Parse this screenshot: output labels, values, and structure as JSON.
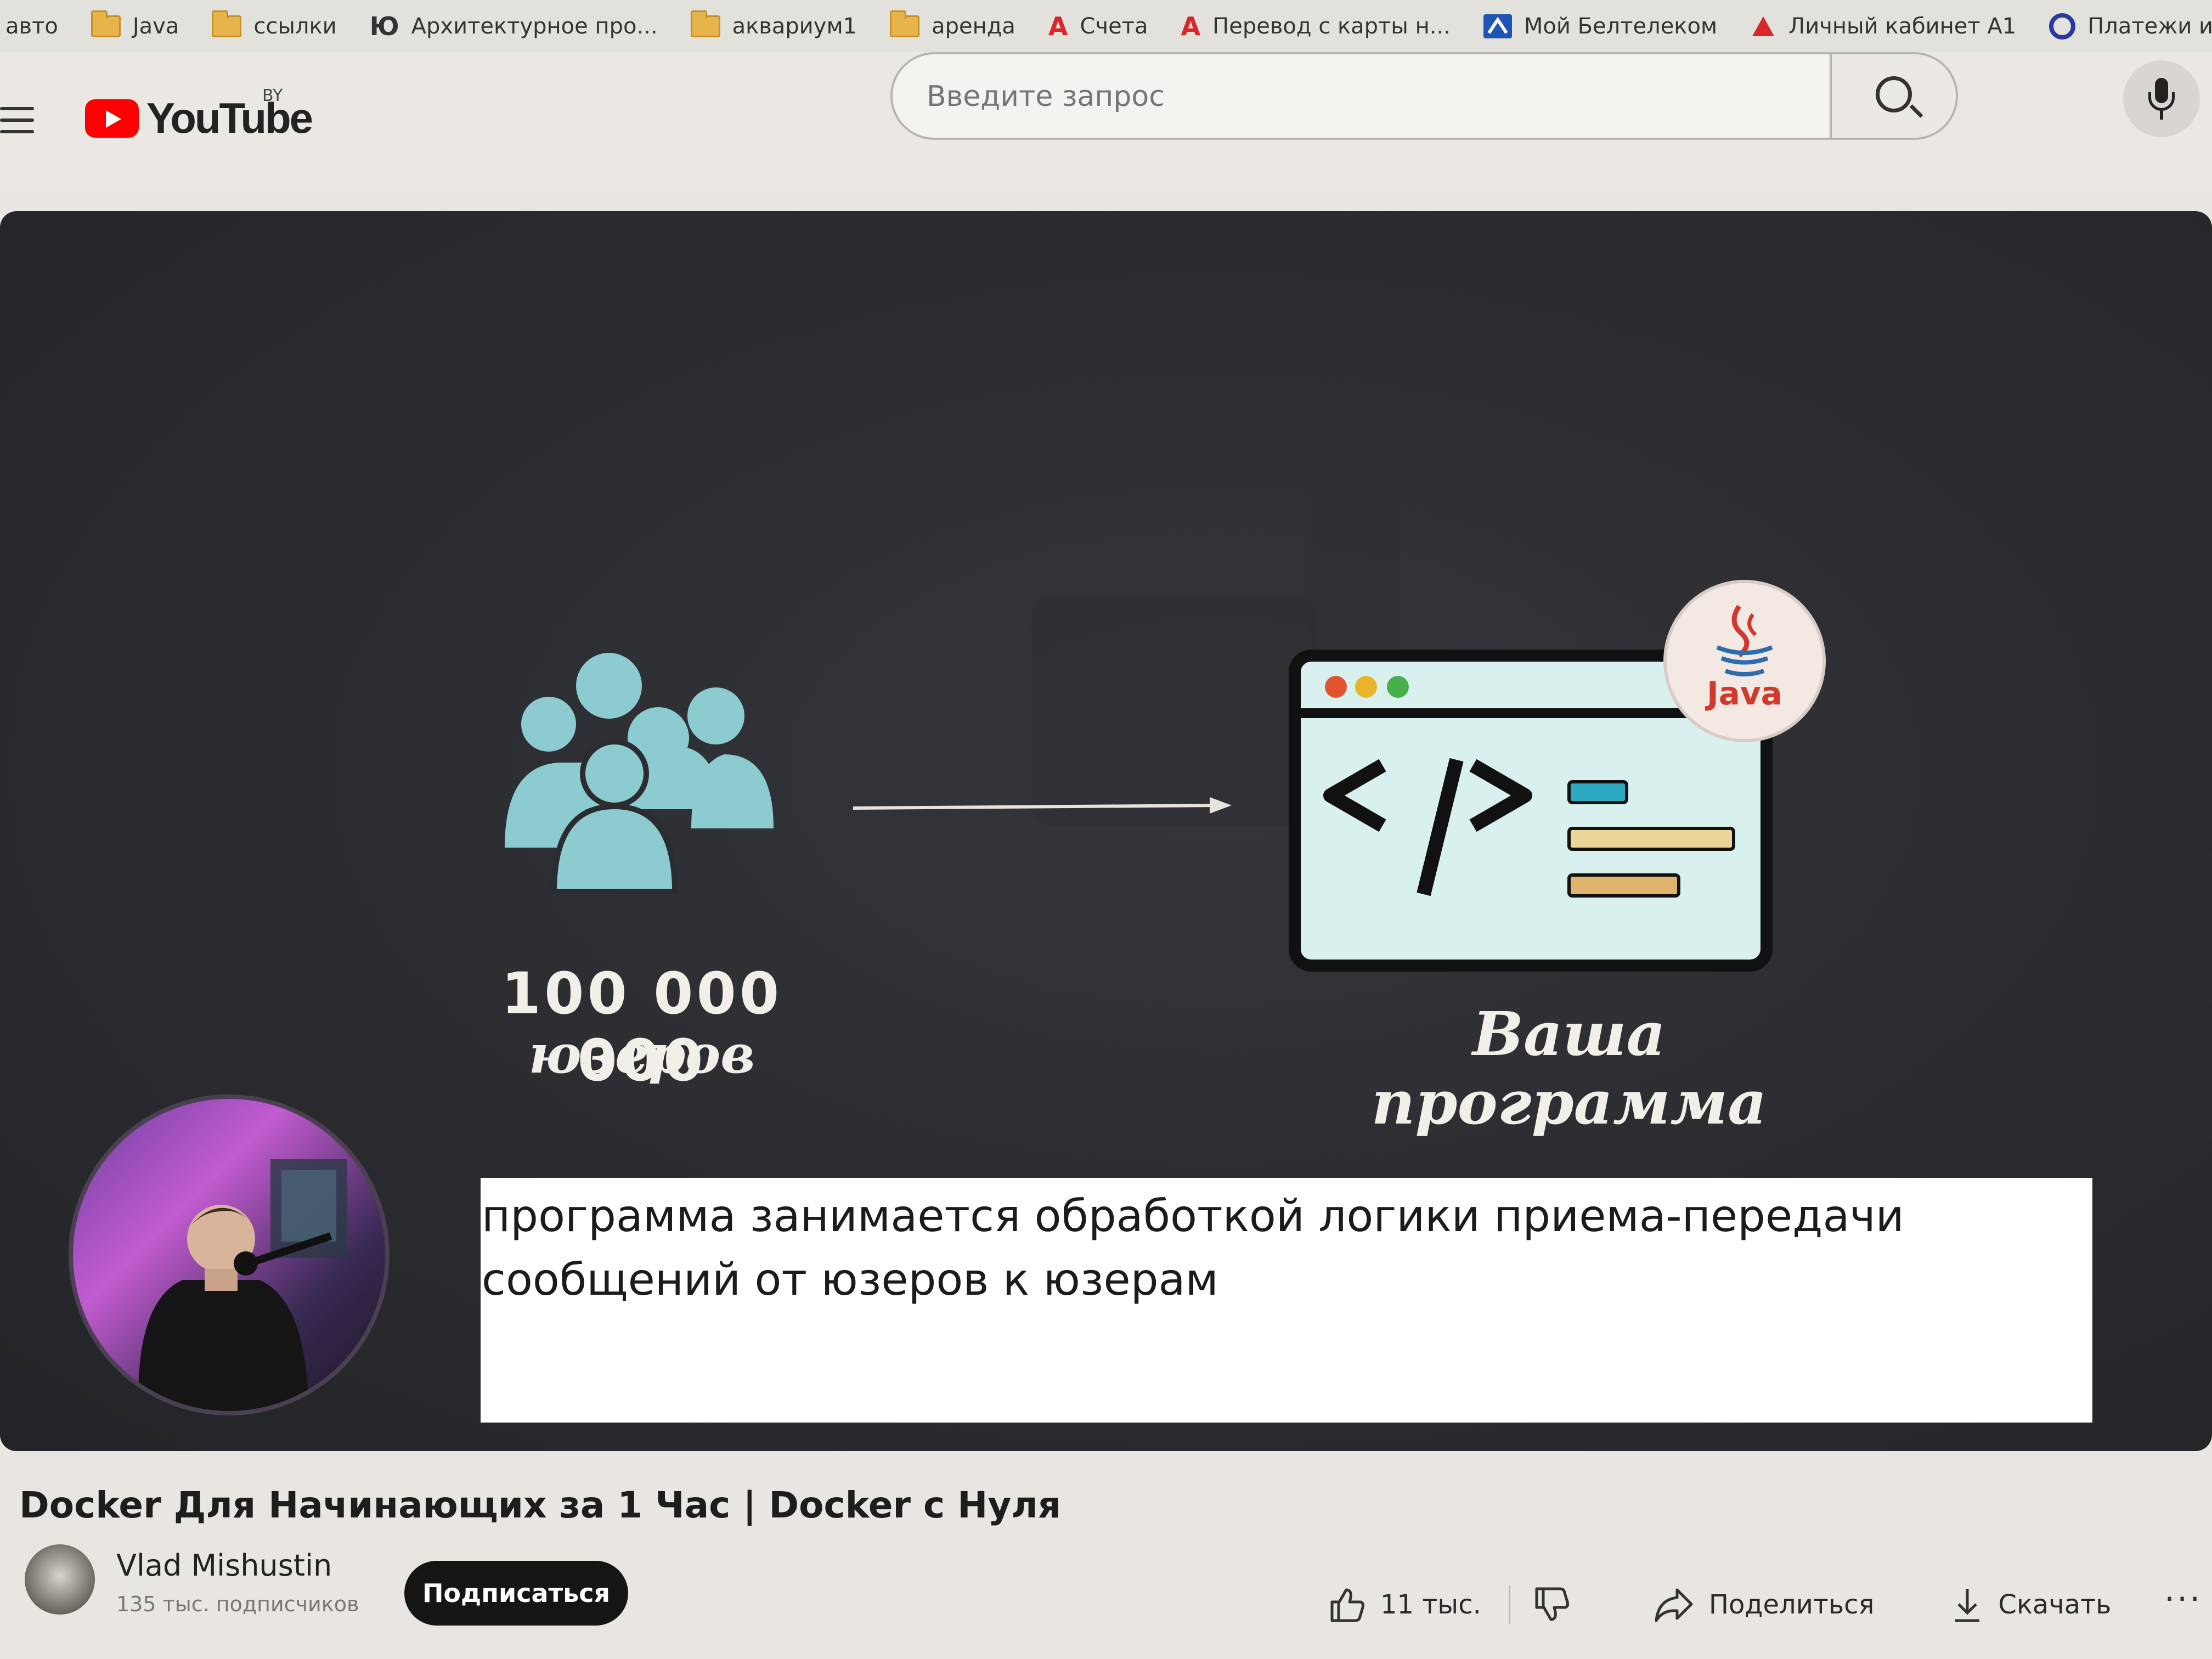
{
  "bookmarks": [
    {
      "label": "авто",
      "icon": "none"
    },
    {
      "label": "Java",
      "icon": "folder-icon"
    },
    {
      "label": "ссылки",
      "icon": "folder-icon"
    },
    {
      "label": "Архитектурное про...",
      "icon": "ju-icon",
      "glyph": "Ю"
    },
    {
      "label": "аквариум1",
      "icon": "folder-icon"
    },
    {
      "label": "аренда",
      "icon": "folder-icon"
    },
    {
      "label": "Счета",
      "icon": "alfa-bank-icon",
      "glyph": "А"
    },
    {
      "label": "Перевод с карты н...",
      "icon": "alfa-bank-icon",
      "glyph": "А"
    },
    {
      "label": "Мой Белтелеком",
      "icon": "beltelecom-icon"
    },
    {
      "label": "Личный кабинет А1",
      "icon": "a1-icon"
    },
    {
      "label": "Платежи и пере...",
      "icon": "payments-icon"
    }
  ],
  "header": {
    "logo_text": "YouTube",
    "region": "BY",
    "search_placeholder": "Введите запрос"
  },
  "player": {
    "users_count": "100 000 000",
    "users_word": "юзеров",
    "java_label": "Java",
    "program_line1": "Ваша",
    "program_line2": "программа",
    "caption": "программа занимается обработкой логики приема-передачи сообщений от юзеров к юзерам"
  },
  "video": {
    "title": "Docker Для Начинающих за 1 Час | Docker с Нуля",
    "channel_name": "Vlad Mishustin",
    "subscribers": "135 тыс. подписчиков",
    "subscribe_label": "Подписаться",
    "likes": "11 тыс.",
    "share_label": "Поделиться",
    "download_label": "Скачать",
    "more_label": "···"
  },
  "colors": {
    "youtube_red": "#ff0000",
    "people_teal": "#8ccbd0",
    "window_fill": "#d9f1ee",
    "caption_bg": "#ffffff",
    "player_bg": "#2b2c30"
  }
}
